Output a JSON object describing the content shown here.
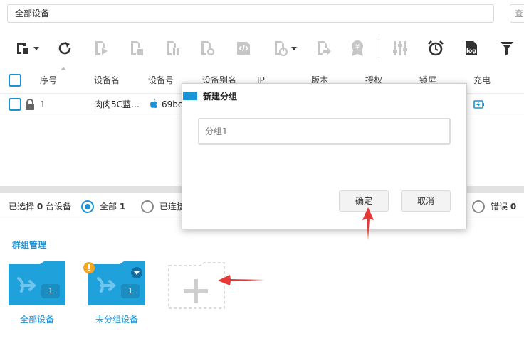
{
  "top": {
    "group_select_value": "全部设备",
    "search_edge_text": "查"
  },
  "toolbar": {
    "icons": [
      "device-select-icon",
      "refresh-icon",
      "play-icon",
      "file-icon",
      "file-info-icon",
      "file-sync-icon",
      "script-icon",
      "power-icon",
      "export-icon",
      "badge-icon",
      "sliders-icon",
      "alarm-clock-icon",
      "log-icon",
      "filter-icon"
    ],
    "log_label": "log"
  },
  "table": {
    "headers": [
      "序号",
      "设备名",
      "设备号",
      "设备别名",
      "IP",
      "版本",
      "授权",
      "锁屏",
      "充电"
    ],
    "rows": [
      {
        "index": "1",
        "name": "肉肉5C蓝…",
        "device_id": "69bc"
      }
    ]
  },
  "status": {
    "selected_prefix": "已选择",
    "selected_count": "0",
    "selected_suffix": "台设备",
    "all_label": "全部",
    "all_count": "1",
    "connected_label": "已连接",
    "error_label": "错误",
    "error_count": "0"
  },
  "groups": {
    "title": "群组管理",
    "items": [
      {
        "label": "全部设备",
        "count": "1"
      },
      {
        "label": "未分组设备",
        "count": "1"
      }
    ]
  },
  "dialog": {
    "title": "新建分组",
    "input_placeholder": "分组1",
    "confirm_label": "确定",
    "cancel_label": "取消"
  },
  "colors": {
    "accent": "#1a93d6",
    "folder": "#1fa1dc",
    "arrow": "#e53935",
    "warning": "#f5a623"
  }
}
